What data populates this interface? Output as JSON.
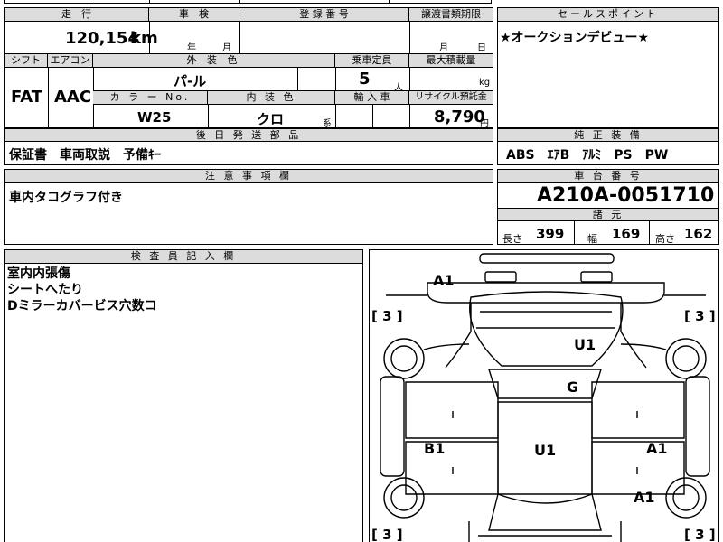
{
  "top_partial": {
    "left": "ー",
    "mid": "日",
    "right": "ー"
  },
  "odometer": {
    "header": "走　行",
    "value": "120,154",
    "unit": "km"
  },
  "inspection": {
    "header": "車　検",
    "year_unit": "年",
    "month_unit": "月"
  },
  "registration": {
    "header": "登 録 番 号"
  },
  "transfer": {
    "header": "譲渡書類期限",
    "month_unit": "月",
    "day_unit": "日"
  },
  "sales_point": {
    "header": "セールスポイント",
    "text": "★オークションデビュー★"
  },
  "shift": {
    "header": "シフト",
    "value": "FAT"
  },
  "aircon": {
    "header": "エアコン",
    "value": "AAC"
  },
  "exterior_color": {
    "header": "外 装 色",
    "value": "パ-ル"
  },
  "capacity": {
    "header": "乗車定員",
    "value": "5",
    "unit": "人"
  },
  "max_load": {
    "header": "最大積載量",
    "unit": "kg"
  },
  "color_no": {
    "header": "カ ラ ー No.",
    "value": "W25"
  },
  "interior_color": {
    "header": "内 装 色",
    "value": "クロ",
    "suffix": "系"
  },
  "import": {
    "header": "輸 入 車"
  },
  "recycle": {
    "header": "リサイクル預託金",
    "value": "8,790",
    "unit": "円"
  },
  "later_parts": {
    "header": "後 日 発 送 部 品",
    "text": "保証書　車両取説　予備ｷｰ"
  },
  "equipment": {
    "header": "純 正 装 備",
    "text": "ABS　ｴｱB　ｱﾙﾐ　PS　PW"
  },
  "notes": {
    "header": "注 意 事 項 欄",
    "text": "車内タコグラフ付き"
  },
  "chassis": {
    "header": "車 台 番 号",
    "value": "A210A-0051710"
  },
  "specs": {
    "header": "諸 元",
    "length_label": "長さ",
    "length": "399",
    "width_label": "幅",
    "width": "169",
    "height_label": "高さ",
    "height": "162"
  },
  "inspector": {
    "header": "検 査 員 記 入 欄",
    "lines": [
      "室内内張傷",
      "シートへたり",
      "Dミラーカバービス穴数コ"
    ]
  },
  "diagram": {
    "marks": {
      "front_a1": "A1",
      "u1_top": "U1",
      "g": "G",
      "b1": "B1",
      "u1_mid": "U1",
      "a1_right": "A1",
      "a1_lower": "A1",
      "tl_tire": "[ 3 ]",
      "tr_tire": "[ 3 ]",
      "bl_tire": "[ 3 ]",
      "br_tire": "[ 3 ]"
    }
  }
}
